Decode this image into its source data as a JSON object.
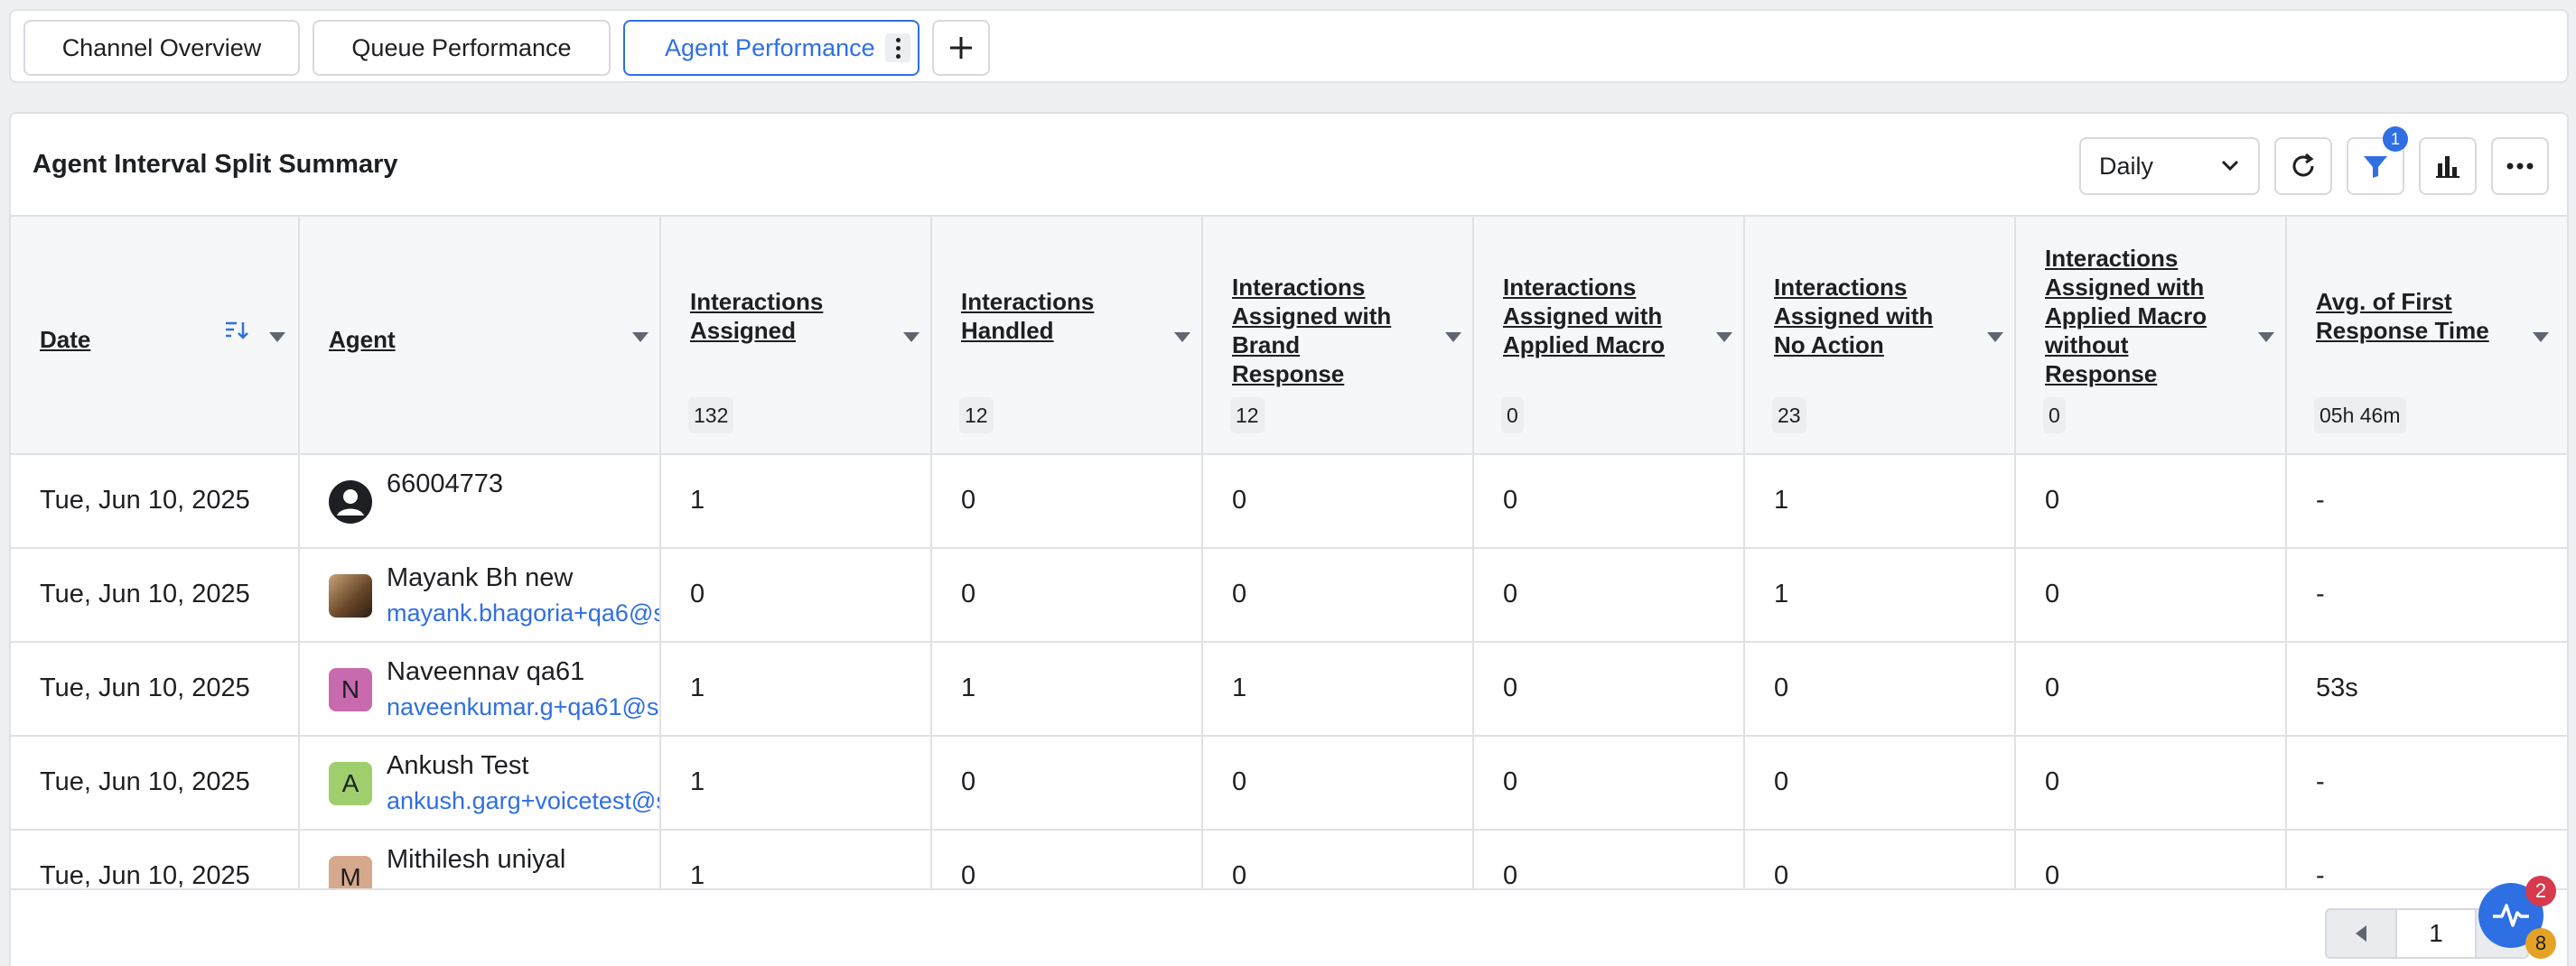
{
  "tabs": [
    {
      "label": "Channel Overview",
      "active": false
    },
    {
      "label": "Queue Performance",
      "active": false
    },
    {
      "label": "Agent Performance",
      "active": true
    }
  ],
  "widget": {
    "title": "Agent Interval Split Summary",
    "interval_select": "Daily",
    "filter_count": "1"
  },
  "columns": [
    {
      "label": "Date",
      "total": ""
    },
    {
      "label": "Agent",
      "total": ""
    },
    {
      "label": "Interactions Assigned",
      "total": "132"
    },
    {
      "label": "Interactions Handled",
      "total": "12"
    },
    {
      "label": "Interactions Assigned with Brand Response",
      "total": "12"
    },
    {
      "label": "Interactions Assigned with Applied Macro",
      "total": "0"
    },
    {
      "label": "Interactions Assigned with No Action",
      "total": "23"
    },
    {
      "label": "Interactions Assigned with Applied Macro without Response",
      "total": "0"
    },
    {
      "label": "Avg. of First Response Time",
      "total": "05h 46m"
    }
  ],
  "rows": [
    {
      "date": "Tue, Jun 10, 2025",
      "agent_name": "66004773",
      "agent_email": "",
      "avatar_letter": "",
      "avatar_type": "person-icon",
      "avatar_color": "#1d1f22",
      "assigned": "1",
      "handled": "0",
      "brand_response": "0",
      "applied_macro": "0",
      "no_action": "1",
      "macro_no_response": "0",
      "first_response": "-"
    },
    {
      "date": "Tue, Jun 10, 2025",
      "agent_name": "Mayank Bh new",
      "agent_email": "mayank.bhagoria+qa6@s",
      "avatar_letter": "",
      "avatar_type": "photo",
      "avatar_color": "#6b4a2c",
      "assigned": "0",
      "handled": "0",
      "brand_response": "0",
      "applied_macro": "0",
      "no_action": "1",
      "macro_no_response": "0",
      "first_response": "-"
    },
    {
      "date": "Tue, Jun 10, 2025",
      "agent_name": "Naveennav qa61",
      "agent_email": "naveenkumar.g+qa61@sp",
      "avatar_letter": "N",
      "avatar_type": "letter",
      "avatar_color": "#c86aae",
      "assigned": "1",
      "handled": "1",
      "brand_response": "1",
      "applied_macro": "0",
      "no_action": "0",
      "macro_no_response": "0",
      "first_response": "53s"
    },
    {
      "date": "Tue, Jun 10, 2025",
      "agent_name": "Ankush Test",
      "agent_email": "ankush.garg+voicetest@s",
      "avatar_letter": "A",
      "avatar_type": "letter",
      "avatar_color": "#9fce6c",
      "assigned": "1",
      "handled": "0",
      "brand_response": "0",
      "applied_macro": "0",
      "no_action": "0",
      "macro_no_response": "0",
      "first_response": "-"
    },
    {
      "date": "Tue, Jun 10, 2025",
      "agent_name": "Mithilesh uniyal",
      "agent_email": "",
      "avatar_letter": "M",
      "avatar_type": "letter",
      "avatar_color": "#d6a98c",
      "assigned": "1",
      "handled": "0",
      "brand_response": "0",
      "applied_macro": "0",
      "no_action": "0",
      "macro_no_response": "0",
      "first_response": "-"
    }
  ],
  "pagination": {
    "current_page": "1"
  },
  "fab": {
    "badge_top": "2",
    "badge_bottom": "8"
  }
}
